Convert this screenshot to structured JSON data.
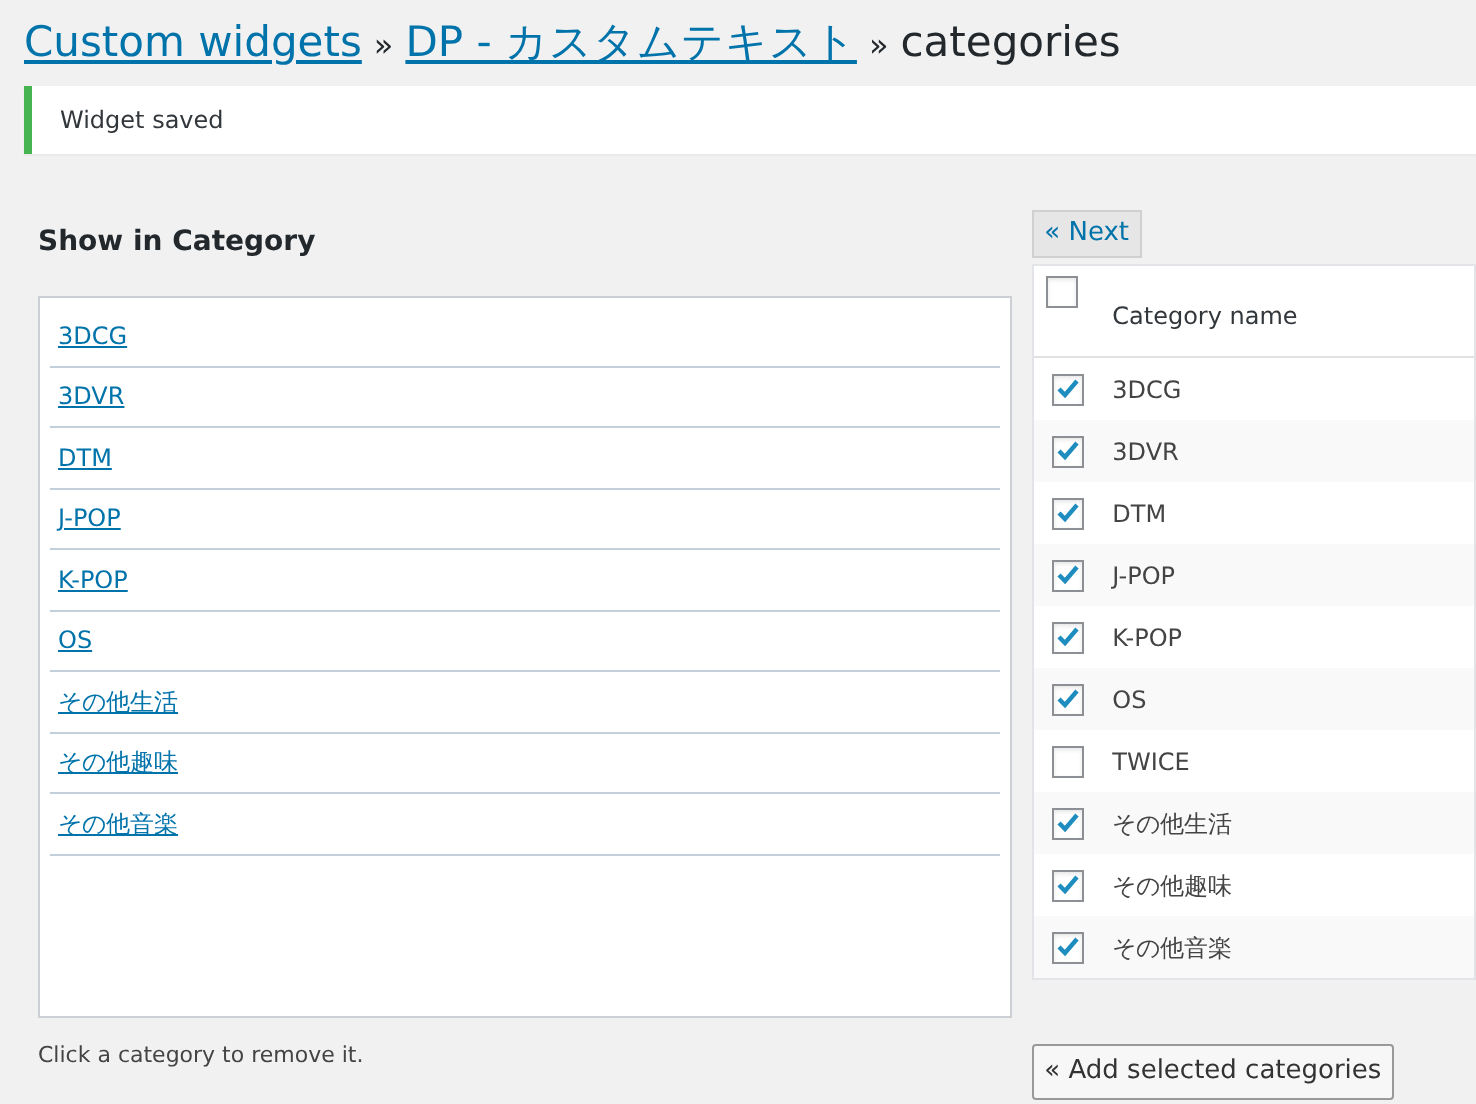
{
  "breadcrumb": {
    "links": [
      "Custom widgets",
      "DP - カスタムテキスト"
    ],
    "separators": [
      "»",
      "»"
    ],
    "current": "categories"
  },
  "notice": "Widget saved",
  "left": {
    "heading": "Show in Category",
    "items": [
      "3DCG",
      "3DVR",
      "DTM",
      "J-POP",
      "K-POP",
      "OS",
      "その他生活",
      "その他趣味",
      "その他音楽"
    ],
    "help": "Click a category to remove it."
  },
  "right": {
    "next_button": "« Next",
    "header": {
      "label": "Category name",
      "checked": false
    },
    "rows": [
      {
        "name": "3DCG",
        "checked": true
      },
      {
        "name": "3DVR",
        "checked": true
      },
      {
        "name": "DTM",
        "checked": true
      },
      {
        "name": "J-POP",
        "checked": true
      },
      {
        "name": "K-POP",
        "checked": true
      },
      {
        "name": "OS",
        "checked": true
      },
      {
        "name": "TWICE",
        "checked": false
      },
      {
        "name": "その他生活",
        "checked": true
      },
      {
        "name": "その他趣味",
        "checked": true
      },
      {
        "name": "その他音楽",
        "checked": true
      }
    ],
    "add_button": "« Add selected categories"
  }
}
